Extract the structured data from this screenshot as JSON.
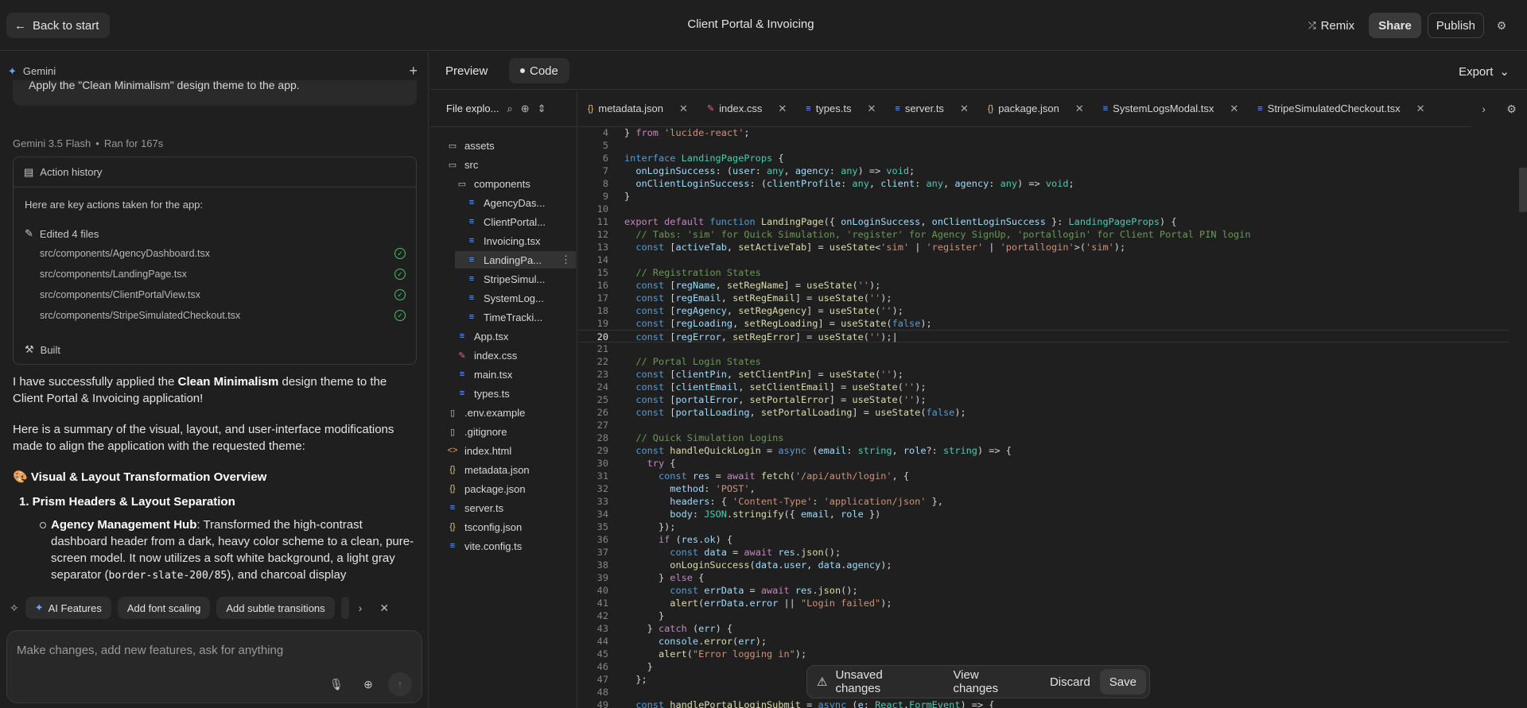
{
  "topbar": {
    "back_label": "Back to start",
    "title": "Client Portal & Invoicing",
    "remix_label": "Remix",
    "share_label": "Share",
    "publish_label": "Publish"
  },
  "chat": {
    "assistant_name": "Gemini",
    "prev_message": "Apply the \"Clean Minimalism\" design theme to the app.",
    "model": "Gemini 3.5 Flash",
    "ran_for": "Ran for 167s",
    "action_history_label": "Action history",
    "action_intro": "Here are key actions taken for the app:",
    "edited_label": "Edited 4 files",
    "edited_files": [
      "src/components/AgencyDashboard.tsx",
      "src/components/LandingPage.tsx",
      "src/components/ClientPortalView.tsx",
      "src/components/StripeSimulatedCheckout.tsx"
    ],
    "built_label": "Built",
    "p1_pre": "I have successfully applied the ",
    "p1_bold": "Clean Minimalism",
    "p1_post": " design theme to the Client Portal & Invoicing application!",
    "p2": "Here is a summary of the visual, layout, and user-interface modifications made to align the application with the requested theme:",
    "h1_emoji": "🎨",
    "h1": "Visual & Layout Transformation Overview",
    "n1": "1. Prism Headers & Layout Separation",
    "b1_bold": "Agency Management Hub",
    "b1_text": ": Transformed the high-contrast dashboard header from a dark, heavy color scheme to a clean, pure-screen model. It now utilizes a soft white background, a light gray separator (",
    "b1_code": "border-slate-200/85",
    "b1_tail": "), and charcoal display",
    "suggestions": [
      "AI Features",
      "Add font scaling",
      "Add subtle transitions"
    ],
    "composer_placeholder": "Make changes, add new features, ask for anything"
  },
  "view_tabs": {
    "preview": "Preview",
    "code": "Code",
    "export": "Export"
  },
  "explorer": {
    "title": "File explo...",
    "items": [
      {
        "label": "assets",
        "icon": "folder-icon"
      },
      {
        "label": "src",
        "icon": "folder-icon"
      },
      {
        "label": "components",
        "icon": "folder-icon"
      },
      {
        "label": "AgencyDas...",
        "icon": "ts-icon"
      },
      {
        "label": "ClientPortal...",
        "icon": "ts-icon"
      },
      {
        "label": "Invoicing.tsx",
        "icon": "ts-icon"
      },
      {
        "label": "LandingPa...",
        "icon": "ts-icon"
      },
      {
        "label": "StripeSimul...",
        "icon": "ts-icon"
      },
      {
        "label": "SystemLog...",
        "icon": "ts-icon"
      },
      {
        "label": "TimeTracki...",
        "icon": "ts-icon"
      },
      {
        "label": "App.tsx",
        "icon": "ts-icon"
      },
      {
        "label": "index.css",
        "icon": "css-icon"
      },
      {
        "label": "main.tsx",
        "icon": "ts-icon"
      },
      {
        "label": "types.ts",
        "icon": "ts-icon"
      },
      {
        "label": ".env.example",
        "icon": "file-icon"
      },
      {
        "label": ".gitignore",
        "icon": "file-icon"
      },
      {
        "label": "index.html",
        "icon": "html-icon"
      },
      {
        "label": "metadata.json",
        "icon": "json-icon"
      },
      {
        "label": "package.json",
        "icon": "json-icon"
      },
      {
        "label": "server.ts",
        "icon": "ts-icon"
      },
      {
        "label": "tsconfig.json",
        "icon": "json-icon"
      },
      {
        "label": "vite.config.ts",
        "icon": "ts-icon"
      }
    ]
  },
  "editor_tabs": [
    {
      "label": "metadata.json",
      "icon": "json-icon"
    },
    {
      "label": "index.css",
      "icon": "css-icon"
    },
    {
      "label": "types.ts",
      "icon": "ts-icon"
    },
    {
      "label": "server.ts",
      "icon": "ts-icon"
    },
    {
      "label": "package.json",
      "icon": "json-icon"
    },
    {
      "label": "SystemLogsModal.tsx",
      "icon": "ts-icon"
    },
    {
      "label": "StripeSimulatedCheckout.tsx",
      "icon": "ts-icon"
    }
  ],
  "code_lines": [
    {
      "n": "4",
      "html": "<span class='p'>} </span><span class='y'>from</span> <span class='s'>'lucide-react'</span><span class='p'>;</span>"
    },
    {
      "n": "5",
      "html": ""
    },
    {
      "n": "6",
      "html": "<span class='k'>interface</span> <span class='t'>LandingPageProps</span> <span class='p'>{</span>"
    },
    {
      "n": "7",
      "html": "  <span class='v'>onLoginSuccess</span><span class='p'>: (</span><span class='v'>user</span><span class='p'>: </span><span class='t'>any</span><span class='p'>, </span><span class='v'>agency</span><span class='p'>: </span><span class='t'>any</span><span class='p'>) =&gt; </span><span class='t'>void</span><span class='p'>;</span>"
    },
    {
      "n": "8",
      "html": "  <span class='v'>onClientLoginSuccess</span><span class='p'>: (</span><span class='v'>clientProfile</span><span class='p'>: </span><span class='t'>any</span><span class='p'>, </span><span class='v'>client</span><span class='p'>: </span><span class='t'>any</span><span class='p'>, </span><span class='v'>agency</span><span class='p'>: </span><span class='t'>any</span><span class='p'>) =&gt; </span><span class='t'>void</span><span class='p'>;</span>"
    },
    {
      "n": "9",
      "html": "<span class='p'>}</span>"
    },
    {
      "n": "10",
      "html": ""
    },
    {
      "n": "11",
      "html": "<span class='y'>export</span> <span class='y'>default</span> <span class='k'>function</span> <span class='f'>LandingPage</span><span class='p'>({ </span><span class='v'>onLoginSuccess</span><span class='p'>, </span><span class='v'>onClientLoginSuccess</span><span class='p'> }: </span><span class='t'>LandingPageProps</span><span class='p'>) {</span>"
    },
    {
      "n": "12",
      "html": "  <span class='c'>// Tabs: 'sim' for Quick Simulation, 'register' for Agency SignUp, 'portallogin' for Client Portal PIN login</span>"
    },
    {
      "n": "13",
      "html": "  <span class='k'>const</span> <span class='p'>[</span><span class='v'>activeTab</span><span class='p'>, </span><span class='f'>setActiveTab</span><span class='p'>] = </span><span class='f'>useState</span><span class='p'>&lt;</span><span class='s'>'sim'</span><span class='p'> | </span><span class='s'>'register'</span><span class='p'> | </span><span class='s'>'portallogin'</span><span class='p'>&gt;(</span><span class='s'>'sim'</span><span class='p'>);</span>"
    },
    {
      "n": "14",
      "html": ""
    },
    {
      "n": "15",
      "html": "  <span class='c'>// Registration States</span>"
    },
    {
      "n": "16",
      "html": "  <span class='k'>const</span> <span class='p'>[</span><span class='v'>regName</span><span class='p'>, </span><span class='f'>setRegName</span><span class='p'>] = </span><span class='f'>useState</span><span class='p'>(</span><span class='s'>''</span><span class='p'>);</span>"
    },
    {
      "n": "17",
      "html": "  <span class='k'>const</span> <span class='p'>[</span><span class='v'>regEmail</span><span class='p'>, </span><span class='f'>setRegEmail</span><span class='p'>] = </span><span class='f'>useState</span><span class='p'>(</span><span class='s'>''</span><span class='p'>);</span>"
    },
    {
      "n": "18",
      "html": "  <span class='k'>const</span> <span class='p'>[</span><span class='v'>regAgency</span><span class='p'>, </span><span class='f'>setRegAgency</span><span class='p'>] = </span><span class='f'>useState</span><span class='p'>(</span><span class='s'>''</span><span class='p'>);</span>"
    },
    {
      "n": "19",
      "html": "  <span class='k'>const</span> <span class='p'>[</span><span class='v'>regLoading</span><span class='p'>, </span><span class='f'>setRegLoading</span><span class='p'>] = </span><span class='f'>useState</span><span class='p'>(</span><span class='k'>false</span><span class='p'>);</span>"
    },
    {
      "n": "20",
      "html": "  <span class='k'>const</span> <span class='p'>[</span><span class='v'>regError</span><span class='p'>, </span><span class='f'>setRegError</span><span class='p'>] = </span><span class='f'>useState</span><span class='p'>(</span><span class='s'>''</span><span class='p'>);|</span>",
      "current": true
    },
    {
      "n": "21",
      "html": ""
    },
    {
      "n": "22",
      "html": "  <span class='c'>// Portal Login States</span>"
    },
    {
      "n": "23",
      "html": "  <span class='k'>const</span> <span class='p'>[</span><span class='v'>clientPin</span><span class='p'>, </span><span class='f'>setClientPin</span><span class='p'>] = </span><span class='f'>useState</span><span class='p'>(</span><span class='s'>''</span><span class='p'>);</span>"
    },
    {
      "n": "24",
      "html": "  <span class='k'>const</span> <span class='p'>[</span><span class='v'>clientEmail</span><span class='p'>, </span><span class='f'>setClientEmail</span><span class='p'>] = </span><span class='f'>useState</span><span class='p'>(</span><span class='s'>''</span><span class='p'>);</span>"
    },
    {
      "n": "25",
      "html": "  <span class='k'>const</span> <span class='p'>[</span><span class='v'>portalError</span><span class='p'>, </span><span class='f'>setPortalError</span><span class='p'>] = </span><span class='f'>useState</span><span class='p'>(</span><span class='s'>''</span><span class='p'>);</span>"
    },
    {
      "n": "26",
      "html": "  <span class='k'>const</span> <span class='p'>[</span><span class='v'>portalLoading</span><span class='p'>, </span><span class='f'>setPortalLoading</span><span class='p'>] = </span><span class='f'>useState</span><span class='p'>(</span><span class='k'>false</span><span class='p'>);</span>"
    },
    {
      "n": "27",
      "html": ""
    },
    {
      "n": "28",
      "html": "  <span class='c'>// Quick Simulation Logins</span>"
    },
    {
      "n": "29",
      "html": "  <span class='k'>const</span> <span class='f'>handleQuickLogin</span><span class='p'> = </span><span class='k'>async</span> <span class='p'>(</span><span class='v'>email</span><span class='p'>: </span><span class='t'>string</span><span class='p'>, </span><span class='v'>role</span><span class='p'>?: </span><span class='t'>string</span><span class='p'>) =&gt; {</span>"
    },
    {
      "n": "30",
      "html": "    <span class='y'>try</span> <span class='p'>{</span>"
    },
    {
      "n": "31",
      "html": "      <span class='k'>const</span> <span class='v'>res</span><span class='p'> = </span><span class='y'>await</span> <span class='f'>fetch</span><span class='p'>(</span><span class='s'>'/api/auth/login'</span><span class='p'>, {</span>"
    },
    {
      "n": "32",
      "html": "        <span class='v'>method</span><span class='p'>: </span><span class='s'>'POST'</span><span class='p'>,</span>"
    },
    {
      "n": "33",
      "html": "        <span class='v'>headers</span><span class='p'>: { </span><span class='s'>'Content-Type'</span><span class='p'>: </span><span class='s'>'application/json'</span><span class='p'> },</span>"
    },
    {
      "n": "34",
      "html": "        <span class='v'>body</span><span class='p'>: </span><span class='t'>JSON</span><span class='p'>.</span><span class='f'>stringify</span><span class='p'>({ </span><span class='v'>email</span><span class='p'>, </span><span class='v'>role</span><span class='p'> })</span>"
    },
    {
      "n": "35",
      "html": "      <span class='p'>});</span>"
    },
    {
      "n": "36",
      "html": "      <span class='y'>if</span> <span class='p'>(</span><span class='v'>res</span><span class='p'>.</span><span class='v'>ok</span><span class='p'>) {</span>"
    },
    {
      "n": "37",
      "html": "        <span class='k'>const</span> <span class='v'>data</span><span class='p'> = </span><span class='y'>await</span> <span class='v'>res</span><span class='p'>.</span><span class='f'>json</span><span class='p'>();</span>"
    },
    {
      "n": "38",
      "html": "        <span class='f'>onLoginSuccess</span><span class='p'>(</span><span class='v'>data</span><span class='p'>.</span><span class='v'>user</span><span class='p'>, </span><span class='v'>data</span><span class='p'>.</span><span class='v'>agency</span><span class='p'>);</span>"
    },
    {
      "n": "39",
      "html": "      <span class='p'>} </span><span class='y'>else</span> <span class='p'>{</span>"
    },
    {
      "n": "40",
      "html": "        <span class='k'>const</span> <span class='v'>errData</span><span class='p'> = </span><span class='y'>await</span> <span class='v'>res</span><span class='p'>.</span><span class='f'>json</span><span class='p'>();</span>"
    },
    {
      "n": "41",
      "html": "        <span class='f'>alert</span><span class='p'>(</span><span class='v'>errData</span><span class='p'>.</span><span class='v'>error</span><span class='p'> || </span><span class='s'>\"Login failed\"</span><span class='p'>);</span>"
    },
    {
      "n": "42",
      "html": "      <span class='p'>}</span>"
    },
    {
      "n": "43",
      "html": "    <span class='p'>} </span><span class='y'>catch</span> <span class='p'>(</span><span class='v'>err</span><span class='p'>) {</span>"
    },
    {
      "n": "44",
      "html": "      <span class='v'>console</span><span class='p'>.</span><span class='f'>error</span><span class='p'>(</span><span class='v'>err</span><span class='p'>);</span>"
    },
    {
      "n": "45",
      "html": "      <span class='f'>alert</span><span class='p'>(</span><span class='s'>\"Error logging in\"</span><span class='p'>);</span>"
    },
    {
      "n": "46",
      "html": "    <span class='p'>}</span>"
    },
    {
      "n": "47",
      "html": "  <span class='p'>};</span>"
    },
    {
      "n": "48",
      "html": ""
    },
    {
      "n": "49",
      "html": "  <span class='k'>const</span> <span class='f'>handlePortalLoginSubmit</span><span class='p'> = </span><span class='k'>async</span> <span class='p'>(</span><span class='v'>e</span><span class='p'>: </span><span class='t'>React</span><span class='p'>.</span><span class='t'>FormEvent</span><span class='p'>) =&gt; {</span>"
    }
  ],
  "unsaved": {
    "label": "Unsaved changes",
    "view_changes": "View changes",
    "discard": "Discard",
    "save": "Save"
  }
}
